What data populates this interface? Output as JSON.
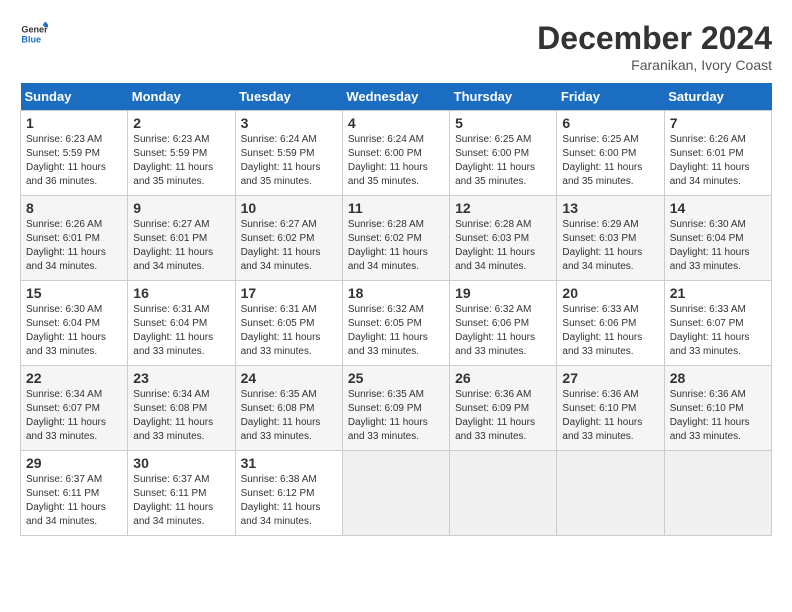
{
  "logo": {
    "line1": "General",
    "line2": "Blue"
  },
  "title": "December 2024",
  "subtitle": "Faranikan, Ivory Coast",
  "days_header": [
    "Sunday",
    "Monday",
    "Tuesday",
    "Wednesday",
    "Thursday",
    "Friday",
    "Saturday"
  ],
  "weeks": [
    [
      {
        "day": 1,
        "sunrise": "6:23 AM",
        "sunset": "5:59 PM",
        "daylight": "11 hours and 36 minutes."
      },
      {
        "day": 2,
        "sunrise": "6:23 AM",
        "sunset": "5:59 PM",
        "daylight": "11 hours and 35 minutes."
      },
      {
        "day": 3,
        "sunrise": "6:24 AM",
        "sunset": "5:59 PM",
        "daylight": "11 hours and 35 minutes."
      },
      {
        "day": 4,
        "sunrise": "6:24 AM",
        "sunset": "6:00 PM",
        "daylight": "11 hours and 35 minutes."
      },
      {
        "day": 5,
        "sunrise": "6:25 AM",
        "sunset": "6:00 PM",
        "daylight": "11 hours and 35 minutes."
      },
      {
        "day": 6,
        "sunrise": "6:25 AM",
        "sunset": "6:00 PM",
        "daylight": "11 hours and 35 minutes."
      },
      {
        "day": 7,
        "sunrise": "6:26 AM",
        "sunset": "6:01 PM",
        "daylight": "11 hours and 34 minutes."
      }
    ],
    [
      {
        "day": 8,
        "sunrise": "6:26 AM",
        "sunset": "6:01 PM",
        "daylight": "11 hours and 34 minutes."
      },
      {
        "day": 9,
        "sunrise": "6:27 AM",
        "sunset": "6:01 PM",
        "daylight": "11 hours and 34 minutes."
      },
      {
        "day": 10,
        "sunrise": "6:27 AM",
        "sunset": "6:02 PM",
        "daylight": "11 hours and 34 minutes."
      },
      {
        "day": 11,
        "sunrise": "6:28 AM",
        "sunset": "6:02 PM",
        "daylight": "11 hours and 34 minutes."
      },
      {
        "day": 12,
        "sunrise": "6:28 AM",
        "sunset": "6:03 PM",
        "daylight": "11 hours and 34 minutes."
      },
      {
        "day": 13,
        "sunrise": "6:29 AM",
        "sunset": "6:03 PM",
        "daylight": "11 hours and 34 minutes."
      },
      {
        "day": 14,
        "sunrise": "6:30 AM",
        "sunset": "6:04 PM",
        "daylight": "11 hours and 33 minutes."
      }
    ],
    [
      {
        "day": 15,
        "sunrise": "6:30 AM",
        "sunset": "6:04 PM",
        "daylight": "11 hours and 33 minutes."
      },
      {
        "day": 16,
        "sunrise": "6:31 AM",
        "sunset": "6:04 PM",
        "daylight": "11 hours and 33 minutes."
      },
      {
        "day": 17,
        "sunrise": "6:31 AM",
        "sunset": "6:05 PM",
        "daylight": "11 hours and 33 minutes."
      },
      {
        "day": 18,
        "sunrise": "6:32 AM",
        "sunset": "6:05 PM",
        "daylight": "11 hours and 33 minutes."
      },
      {
        "day": 19,
        "sunrise": "6:32 AM",
        "sunset": "6:06 PM",
        "daylight": "11 hours and 33 minutes."
      },
      {
        "day": 20,
        "sunrise": "6:33 AM",
        "sunset": "6:06 PM",
        "daylight": "11 hours and 33 minutes."
      },
      {
        "day": 21,
        "sunrise": "6:33 AM",
        "sunset": "6:07 PM",
        "daylight": "11 hours and 33 minutes."
      }
    ],
    [
      {
        "day": 22,
        "sunrise": "6:34 AM",
        "sunset": "6:07 PM",
        "daylight": "11 hours and 33 minutes."
      },
      {
        "day": 23,
        "sunrise": "6:34 AM",
        "sunset": "6:08 PM",
        "daylight": "11 hours and 33 minutes."
      },
      {
        "day": 24,
        "sunrise": "6:35 AM",
        "sunset": "6:08 PM",
        "daylight": "11 hours and 33 minutes."
      },
      {
        "day": 25,
        "sunrise": "6:35 AM",
        "sunset": "6:09 PM",
        "daylight": "11 hours and 33 minutes."
      },
      {
        "day": 26,
        "sunrise": "6:36 AM",
        "sunset": "6:09 PM",
        "daylight": "11 hours and 33 minutes."
      },
      {
        "day": 27,
        "sunrise": "6:36 AM",
        "sunset": "6:10 PM",
        "daylight": "11 hours and 33 minutes."
      },
      {
        "day": 28,
        "sunrise": "6:36 AM",
        "sunset": "6:10 PM",
        "daylight": "11 hours and 33 minutes."
      }
    ],
    [
      {
        "day": 29,
        "sunrise": "6:37 AM",
        "sunset": "6:11 PM",
        "daylight": "11 hours and 34 minutes."
      },
      {
        "day": 30,
        "sunrise": "6:37 AM",
        "sunset": "6:11 PM",
        "daylight": "11 hours and 34 minutes."
      },
      {
        "day": 31,
        "sunrise": "6:38 AM",
        "sunset": "6:12 PM",
        "daylight": "11 hours and 34 minutes."
      },
      null,
      null,
      null,
      null
    ]
  ],
  "labels": {
    "sunrise": "Sunrise:",
    "sunset": "Sunset:",
    "daylight": "Daylight:"
  }
}
